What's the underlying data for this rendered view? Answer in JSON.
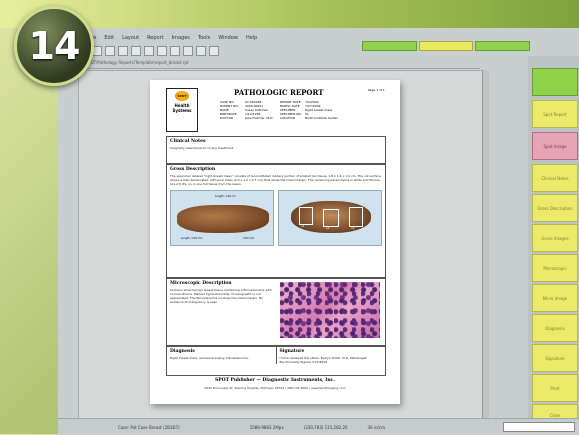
{
  "badge": {
    "number": "14"
  },
  "app": {
    "menu": [
      "File",
      "Edit",
      "Layout",
      "Report",
      "Images",
      "Tools",
      "Window",
      "Help"
    ],
    "path_text": "C:\\SPOT\\Pathology Reports\\Template\\report_breast.rpt"
  },
  "right_panel": {
    "buttons": [
      "",
      "Spot Report",
      "Spot Image",
      "Clinical Notes",
      "Gross Description",
      "Gross Images",
      "Microscopic",
      "Micro Image",
      "Diagnosis",
      "Signature",
      "Print",
      "Close"
    ]
  },
  "statusbar": {
    "left": "Case: Pat Case Breast (2B3D7)",
    "mid": "1586-9883 2Mpx",
    "right": "(330,783) 115,282,20",
    "zoom": "36 in/cm"
  },
  "report": {
    "title": "PATHOLOGIC REPORT",
    "page": "Page 1 of 1",
    "logo_top": "SPOT",
    "logo_name": "Health Systems",
    "meta": [
      [
        "CASE NO.",
        "07-000188",
        "REPORT DATE",
        "7/2/2009"
      ],
      [
        "PATIENT NO.",
        "2009 00651",
        "BIOPSY DATE",
        "7/27/2009"
      ],
      [
        "NAME",
        "Susan Katzman",
        "SPECIMEN",
        "Right breast mass"
      ],
      [
        "BIRTHDATE",
        "1/12/1956",
        "SPECIMEN NO.",
        "S1"
      ],
      [
        "DOCTOR",
        "Jane Fletcher, M.D.",
        "LOCATION",
        "North Institute Center"
      ]
    ],
    "clinical_title": "Clinical Notes",
    "clinical_text": "Surgically resected prior to any treatment.",
    "gross_title": "Gross Description",
    "gross_text": "The specimen labeled \"right breast mass\" consists of reconstituted rubbery portion of pinkish tan tissue, 1.8 x 1.6 x 1.0 cm. The cut surface shows a well-demarcated, with pink mass (2.0 x 1.0 x 0.7 cm) that abuts the inked margin. The remaining parenchyma is white and fibrous. (A1-A7) RS, no in one full tissue from the lesion.",
    "gross_img1_labels": [
      "Length: 1.90 cm",
      "Length: 3.08 mm",
      "3.63 mm"
    ],
    "gross_img2_labels": [
      "A1",
      "A2",
      "A3"
    ],
    "micro_title": "Microscopic Description",
    "micro_text": "Sections show benign breast tissue containing a fibroadenoma with normal stroma. Marked hyperstromality of overgrowth is not appreciated. The fibroadenoma involves the inked margin. No evidence of malignancy is seen.",
    "diagnosis_title": "Diagnosis",
    "diagnosis_text": "Right breast mass, excisional biopsy: Fibroadenoma.",
    "signature_title": "Signature",
    "signature_text": "I have reviewed the slides. Evelyn Smith, M.D. Pathologist Electronically Signed 7/27/2009",
    "footer_org": "SPOT Publisher — Diagnostic Instruments, Inc.",
    "footer_addr": "6540 Burroughs St. Sterling Heights, Michigan 48314 | 586.731.6000 | www.SpotImaging.com"
  }
}
